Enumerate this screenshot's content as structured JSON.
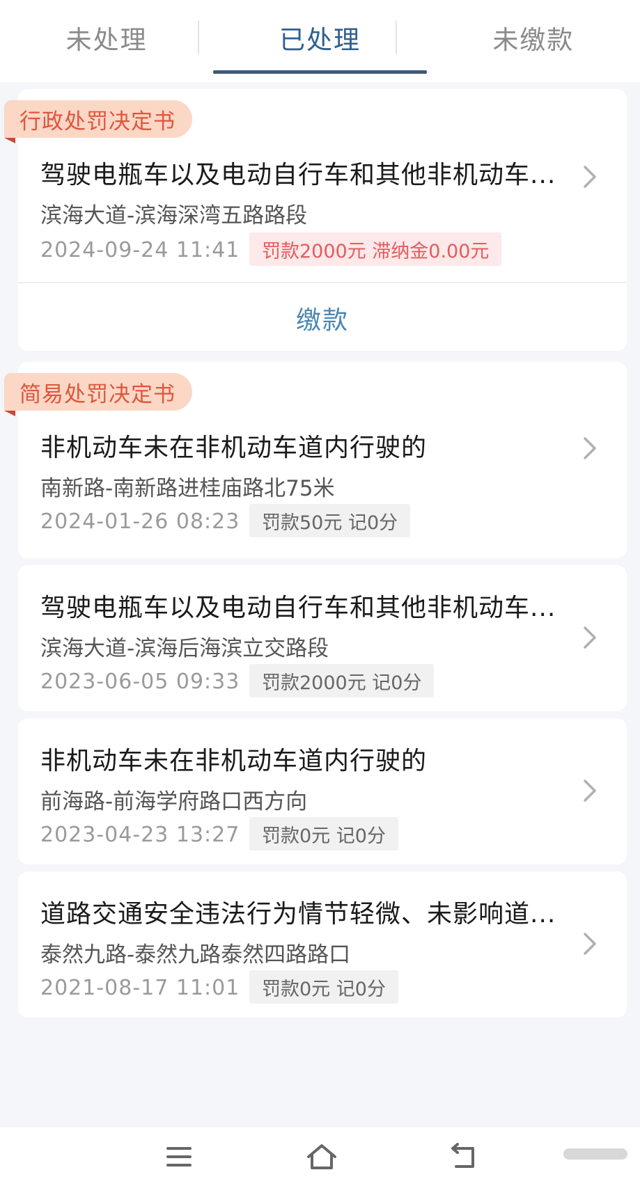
{
  "tabs": [
    {
      "label": "未处理"
    },
    {
      "label": "已处理"
    },
    {
      "label": "未缴款"
    }
  ],
  "sections": [
    {
      "tag": "行政处罚决定书",
      "records": [
        {
          "title": "驾驶电瓶车以及电动自行车和其他非机动车...",
          "location": "滨海大道-滨海深湾五路路段",
          "datetime": "2024-09-24 11:41",
          "penalty": "罚款2000元 滞纳金0.00元"
        }
      ],
      "pay_label": "缴款"
    },
    {
      "tag": "简易处罚决定书",
      "records": [
        {
          "title": "非机动车未在非机动车道内行驶的",
          "location": "南新路-南新路进桂庙路北75米",
          "datetime": "2024-01-26 08:23",
          "penalty": "罚款50元 记0分"
        },
        {
          "title": "驾驶电瓶车以及电动自行车和其他非机动车...",
          "location": "滨海大道-滨海后海滨立交路段",
          "datetime": "2023-06-05 09:33",
          "penalty": "罚款2000元 记0分"
        },
        {
          "title": "非机动车未在非机动车道内行驶的",
          "location": "前海路-前海学府路口西方向",
          "datetime": "2023-04-23 13:27",
          "penalty": "罚款0元 记0分"
        },
        {
          "title": "道路交通安全违法行为情节轻微、未影响道...",
          "location": "泰然九路-泰然九路泰然四路路口",
          "datetime": "2021-08-17 11:01",
          "penalty": "罚款0元 记0分"
        }
      ]
    }
  ],
  "nav": {
    "menu_icon": "menu-icon",
    "home_icon": "home-icon",
    "back_icon": "back-icon"
  },
  "colors": {
    "active_tab": "#2f5f8f",
    "tag_bg": "#fbd7c6",
    "tag_text": "#e0553c",
    "penalty_red": "#e25d5d",
    "pay_blue": "#4a86b3"
  }
}
